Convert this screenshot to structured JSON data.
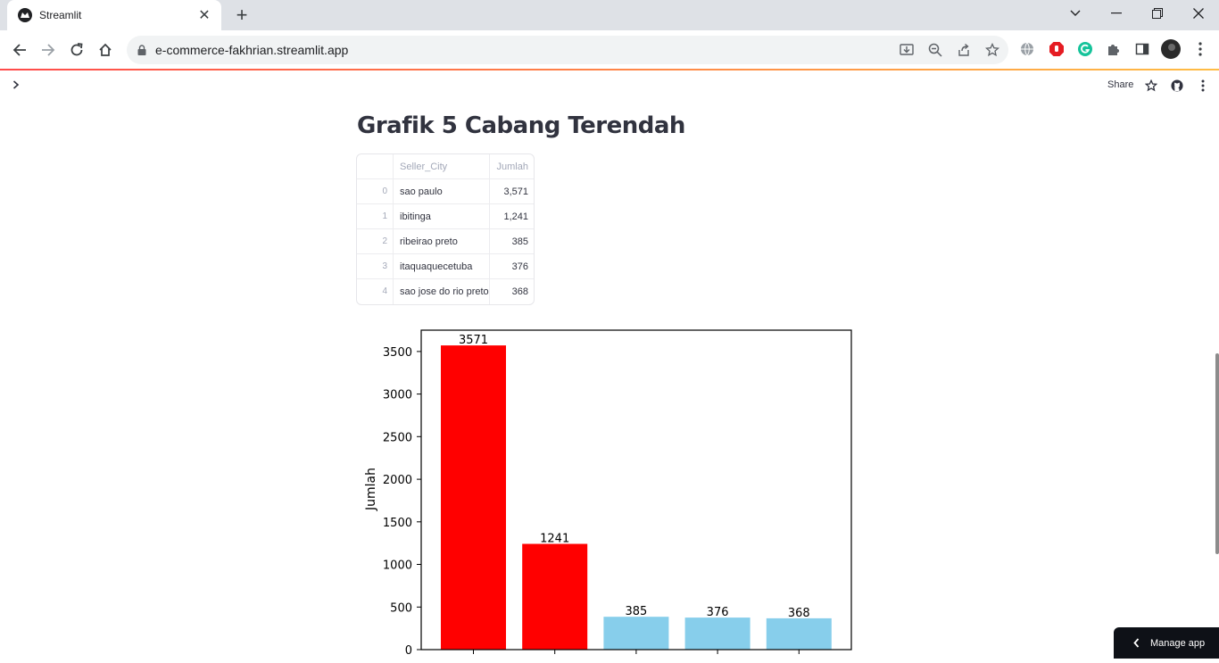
{
  "browser": {
    "tab_title": "Streamlit",
    "url": "e-commerce-fakhrian.streamlit.app"
  },
  "header": {
    "share_label": "Share"
  },
  "page": {
    "title": "Grafik 5 Cabang Terendah"
  },
  "table": {
    "columns": [
      "",
      "Seller_City",
      "Jumlah"
    ],
    "rows": [
      {
        "idx": "0",
        "city": "sao paulo",
        "jumlah": "3,571"
      },
      {
        "idx": "1",
        "city": "ibitinga",
        "jumlah": "1,241"
      },
      {
        "idx": "2",
        "city": "ribeirao preto",
        "jumlah": "385"
      },
      {
        "idx": "3",
        "city": "itaquaquecetuba",
        "jumlah": "376"
      },
      {
        "idx": "4",
        "city": "sao jose do rio preto",
        "jumlah": "368"
      }
    ]
  },
  "chart_data": {
    "type": "bar",
    "categories": [
      "sao paulo",
      "ibitinga",
      "ribeirao preto",
      "itaquaquecetuba",
      "sao jose do rio preto"
    ],
    "values": [
      3571,
      1241,
      385,
      376,
      368
    ],
    "value_labels": [
      "3571",
      "1241",
      "385",
      "376",
      "368"
    ],
    "colors": [
      "#ff0000",
      "#ff0000",
      "#87ceeb",
      "#87ceeb",
      "#87ceeb"
    ],
    "ylabel": "Jumlah",
    "yticks": [
      0,
      500,
      1000,
      1500,
      2000,
      2500,
      3000,
      3500
    ],
    "ytick_labels": [
      "0",
      "500",
      "1000",
      "1500",
      "2000",
      "2500",
      "3000",
      "3500"
    ],
    "grid": false
  },
  "manage_app": {
    "label": "Manage app"
  }
}
